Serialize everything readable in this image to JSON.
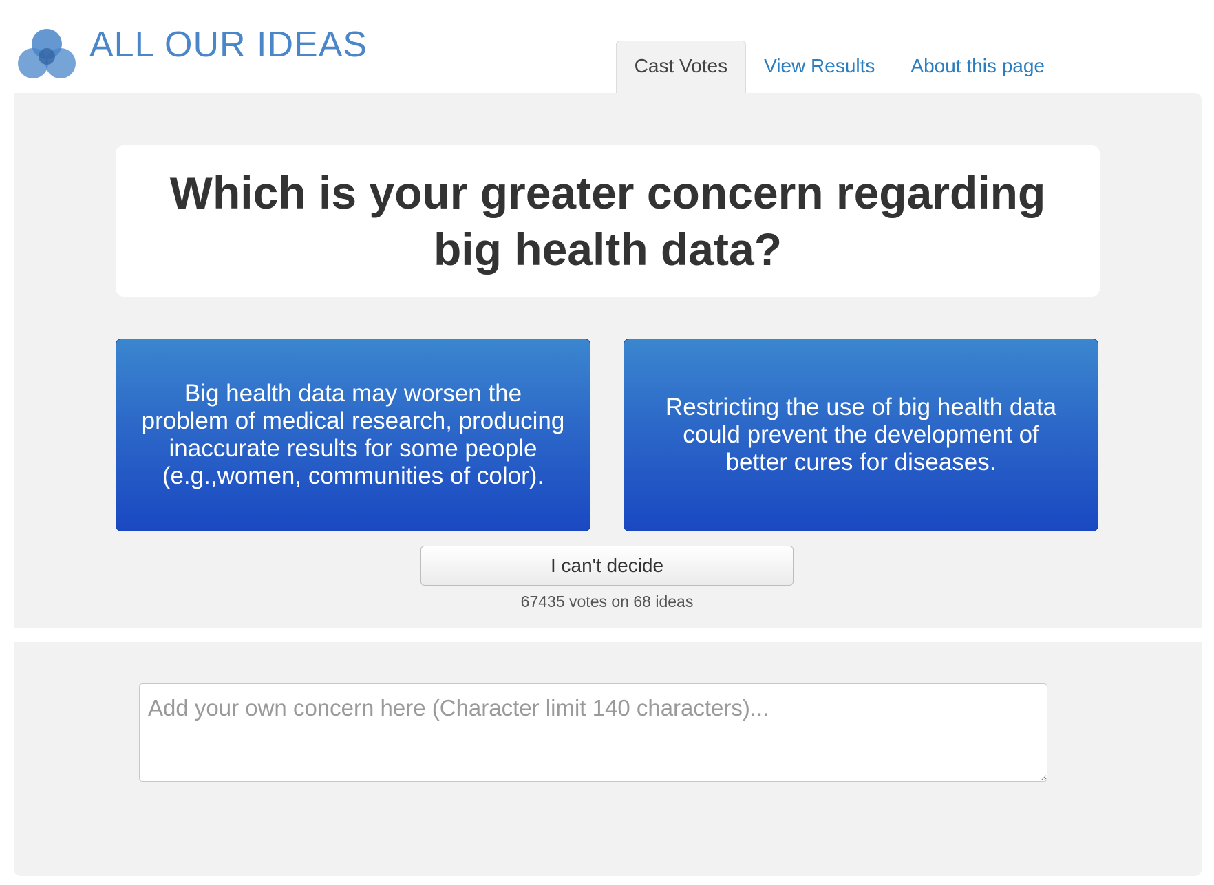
{
  "header": {
    "logo_text": "ALL OUR IDEAS",
    "tabs": [
      {
        "label": "Cast Votes",
        "active": true
      },
      {
        "label": "View Results",
        "active": false
      },
      {
        "label": "About this page",
        "active": false
      }
    ]
  },
  "vote": {
    "question": "Which is your greater concern regarding big health data?",
    "left_choice": "Big health data may worsen the problem of medical research, producing inaccurate results for some people (e.g.,women, communities of color).",
    "right_choice": "Restricting the use of big health data could prevent the development of better cures for diseases.",
    "cant_decide_label": "I can't decide",
    "vote_count": "67435 votes on 68 ideas"
  },
  "add_idea": {
    "placeholder": "Add your own concern here (Character limit 140 characters)...",
    "value": ""
  },
  "colors": {
    "brand": "#4a86c8",
    "link": "#2a7ec0",
    "choice_top": "#3b86cf",
    "choice_bottom": "#1a48c2",
    "panel_bg": "#f2f2f2"
  }
}
